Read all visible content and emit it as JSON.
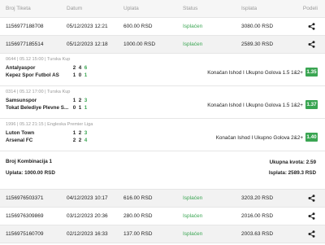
{
  "header": {
    "ticket_id": "Broj Tiketa",
    "date": "Datum",
    "stake": "Uplata",
    "status": "Status",
    "payout": "Isplata",
    "share": "Podeli"
  },
  "tickets_top": [
    {
      "id": "1156977188708",
      "date": "05/12/2023 12:21",
      "stake": "600.00 RSD",
      "status": "Isplaćen",
      "payout": "3080.00 RSD"
    },
    {
      "id": "1156977185514",
      "date": "05/12/2023 12:18",
      "stake": "1000.00 RSD",
      "status": "Isplaćen",
      "payout": "2589.30 RSD"
    }
  ],
  "matches": [
    {
      "meta": "0644 | 05.12 15:00 | Turska Kup",
      "home": "Antalyaspor",
      "away": "Kepez Spor Futbol AS",
      "home_scores": [
        "2",
        "4",
        "6"
      ],
      "away_scores": [
        "1",
        "0",
        "1"
      ],
      "pick": "Konačan Ishod I Ukupno Golova 1.5 1&2+",
      "odd": "1.35"
    },
    {
      "meta": "0314 | 05.12 17:00 | Turska Kup",
      "home": "Samsunspor",
      "away": "Tokat Belediye Plevne S...",
      "home_scores": [
        "1",
        "2",
        "3"
      ],
      "away_scores": [
        "0",
        "1",
        "1"
      ],
      "pick": "Konačan Ishod I Ukupno Golova 1.5 1&2+",
      "odd": "1.37"
    },
    {
      "meta": "1996 | 05.12 21:15 | Engleska Premier Liga",
      "home": "Luton Town",
      "away": "Arsenal FC",
      "home_scores": [
        "1",
        "2",
        "3"
      ],
      "away_scores": [
        "2",
        "2",
        "4"
      ],
      "pick": "Konačan Ishod I Ukupno Golova 2&2+",
      "odd": "1.40"
    }
  ],
  "summary": {
    "combinations": "Broj Kombinacija 1",
    "stake": "Uplata: 1000.00 RSD",
    "total_odd": "Ukupna kvota: 2.59",
    "payout": "Isplata: 2589.3 RSD"
  },
  "tickets_bottom": [
    {
      "id": "1156976503371",
      "date": "04/12/2023 10:17",
      "stake": "616.00 RSD",
      "status": "Isplaćen",
      "payout": "3203.20 RSD"
    },
    {
      "id": "1156976309869",
      "date": "03/12/2023 20:36",
      "stake": "280.00 RSD",
      "status": "Isplaćen",
      "payout": "2016.00 RSD"
    },
    {
      "id": "1156975160709",
      "date": "02/12/2023 16:33",
      "stake": "137.00 RSD",
      "status": "Isplaćen",
      "payout": "2003.63 RSD"
    }
  ],
  "colors": {
    "accent": "#3aa552",
    "shaded_row": "#f2f2f2"
  },
  "icons": {
    "share": "share-icon"
  }
}
